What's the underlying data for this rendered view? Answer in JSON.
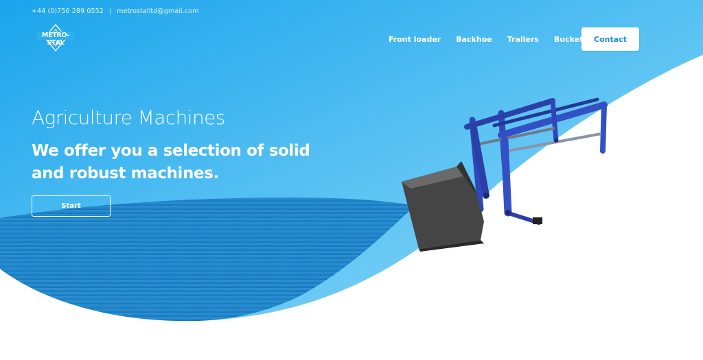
{
  "topbar": {
    "phone": "+44 (0)756 289 0552",
    "separator": "|",
    "email": "metrostalltd@gmail.com"
  },
  "logo": {
    "text": "METRO-STAL",
    "icon": "diamond-logo-icon"
  },
  "nav": {
    "items": [
      {
        "label": "Front loader"
      },
      {
        "label": "Backhoe"
      },
      {
        "label": "Trailers"
      },
      {
        "label": "Buckets"
      }
    ],
    "contact_label": "Contact"
  },
  "hero": {
    "subtitle": "Agriculture Machines",
    "title": "We offer you a selection of solid and robust machines.",
    "start_label": "Start"
  },
  "colors": {
    "sky_top": "#21aaee",
    "sky_bottom": "#7fd0f6",
    "grass": "#1f8ccf",
    "machine": "#2f47b8",
    "bucket": "#3c3c3c",
    "accent": "#1d8fd0"
  }
}
